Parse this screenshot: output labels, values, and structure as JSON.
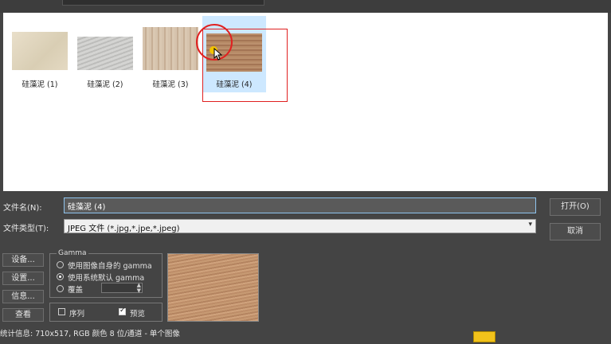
{
  "thumbnails": [
    {
      "caption": "硅藻泥 (1)"
    },
    {
      "caption": "硅藻泥 (2)"
    },
    {
      "caption": "硅藻泥 (3)"
    },
    {
      "caption": "硅藻泥 (4)"
    }
  ],
  "selected_index": 3,
  "filename": {
    "label": "文件名(N):",
    "value": "硅藻泥 (4)"
  },
  "filetype": {
    "label": "文件类型(T):",
    "value": "JPEG 文件 (*.jpg,*.jpe,*.jpeg)"
  },
  "buttons": {
    "open": "打开(O)",
    "cancel": "取消"
  },
  "side_buttons": [
    "设备...",
    "设置...",
    "信息...",
    "查看"
  ],
  "gamma": {
    "title": "Gamma",
    "options": [
      "使用图像自身的 gamma",
      "使用系统默认 gamma",
      "覆盖"
    ],
    "selected": 1
  },
  "checks": {
    "sequence": "序列",
    "preview": "预览",
    "sequence_checked": false,
    "preview_checked": true
  },
  "status": {
    "info": "统计信息: 710x517, RGB 颜色 8 位/通道 - 单个图像"
  },
  "colors": {
    "selection": "#cde8ff",
    "highlight": "#e02020",
    "accent": "#8fc4ee"
  }
}
